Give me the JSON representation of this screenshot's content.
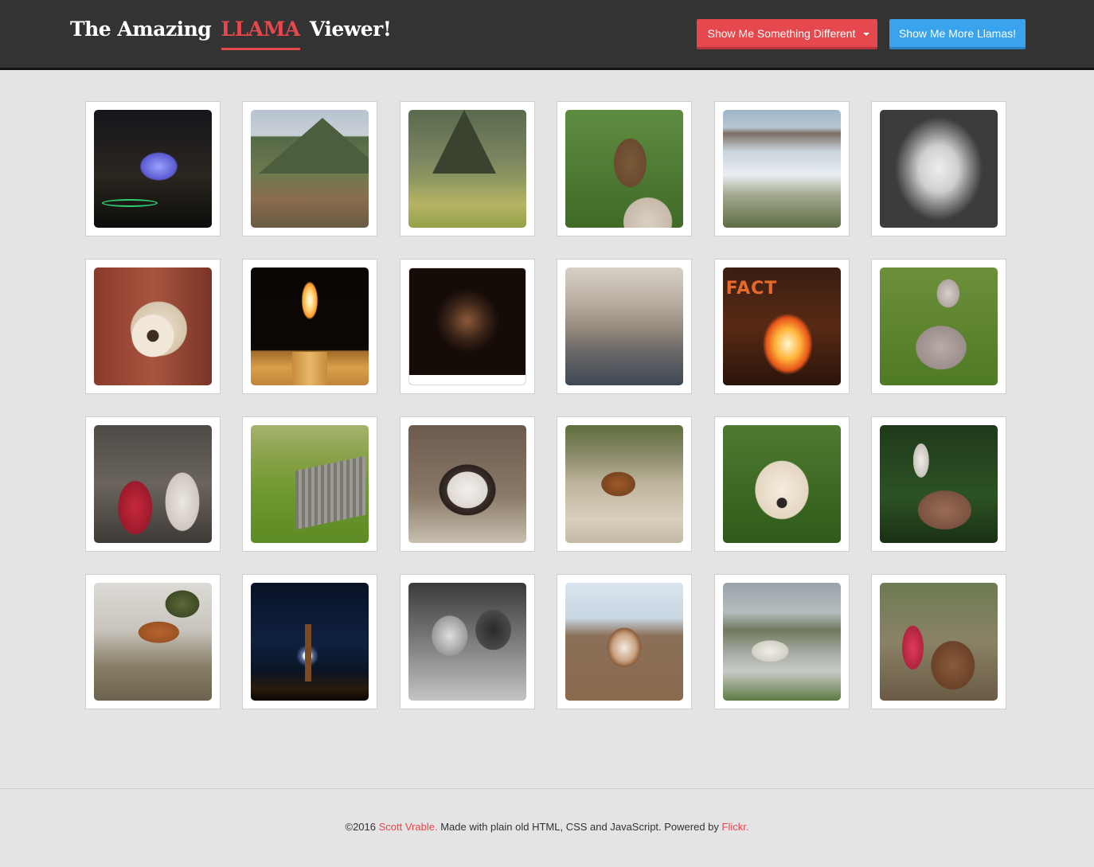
{
  "header": {
    "title_prefix": "The Amazing",
    "title_brand": "LLAMA",
    "title_suffix": "Viewer!",
    "button_different": "Show Me Something Different",
    "button_more": "Show Me More Llamas!",
    "colors": {
      "accent_red": "#e5484d",
      "accent_blue": "#3aa3ee",
      "header_bg": "#333333"
    }
  },
  "gallery": {
    "tiles": [
      {
        "subject": "chapel-at-night"
      },
      {
        "subject": "mountain-valley-llamas"
      },
      {
        "subject": "machu-picchu-llama"
      },
      {
        "subject": "llama-portrait-brown"
      },
      {
        "subject": "llamas-by-lake"
      },
      {
        "subject": "llama-black-white-closeup"
      },
      {
        "subject": "teddy-bear-waving"
      },
      {
        "subject": "candle-flame"
      },
      {
        "subject": "church-altar"
      },
      {
        "subject": "misty-mountains"
      },
      {
        "subject": "fire-performance"
      },
      {
        "subject": "fluffy-llama-resting"
      },
      {
        "subject": "woman-with-llama"
      },
      {
        "subject": "llama-by-shed"
      },
      {
        "subject": "llama-closeup-chewing"
      },
      {
        "subject": "brown-llama-on-rocks"
      },
      {
        "subject": "teddy-bear-bow"
      },
      {
        "subject": "llama-in-forest"
      },
      {
        "subject": "llama-jumping-fence"
      },
      {
        "subject": "night-bonfire-moon"
      },
      {
        "subject": "two-alpacas-bw"
      },
      {
        "subject": "llama-smiling"
      },
      {
        "subject": "white-llamas-by-water"
      },
      {
        "subject": "girl-with-llamas"
      }
    ]
  },
  "footer": {
    "copyright": "©2016 ",
    "author": "Scott Vrable.",
    "made_with": " Made with plain old HTML, CSS and JavaScript. Powered by ",
    "powered_by": "Flickr."
  }
}
